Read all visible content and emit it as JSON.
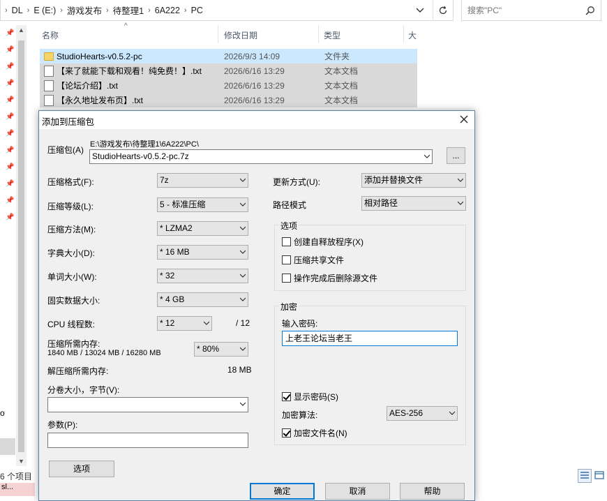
{
  "explorer": {
    "breadcrumbs": [
      "DL",
      "E (E:)",
      "游戏发布",
      "待整理1",
      "6A222",
      "PC"
    ],
    "search_placeholder": "搜索\"PC\"",
    "columns": {
      "name": "名称",
      "date": "修改日期",
      "type": "类型",
      "size": "大"
    },
    "files": [
      {
        "name": "StudioHearts-v0.5.2-pc",
        "date": "2026/9/3 14:09",
        "type": "文件夹",
        "icon": "folder-icon"
      },
      {
        "name": "【来了就能下载和观看！纯免费！】.txt",
        "date": "2026/6/16 13:29",
        "type": "文本文档",
        "icon": "text-file-icon"
      },
      {
        "name": "【论坛介绍】.txt",
        "date": "2026/6/16 13:29",
        "type": "文本文档",
        "icon": "text-file-icon"
      },
      {
        "name": "【永久地址发布页】.txt",
        "date": "2026/6/16 13:29",
        "type": "文本文档",
        "icon": "text-file-icon"
      }
    ],
    "status": "6 个项目",
    "left_edge_char": "o",
    "taskbar_text": "sl..."
  },
  "dialog": {
    "title": "添加到压缩包",
    "archive_label": "压缩包(A)",
    "archive_path": "E:\\游戏发布\\待整理1\\6A222\\PC\\",
    "archive_name": "StudioHearts-v0.5.2-pc.7z",
    "browse_label": "...",
    "format_label": "压缩格式(F):",
    "format_value": "7z",
    "level_label": "压缩等级(L):",
    "level_value": "5 - 标准压缩",
    "method_label": "压缩方法(M):",
    "method_value": "* LZMA2",
    "dict_label": "字典大小(D):",
    "dict_value": "* 16 MB",
    "word_label": "单词大小(W):",
    "word_value": "* 32",
    "solid_label": "固实数据大小:",
    "solid_value": "* 4 GB",
    "threads_label": "CPU 线程数:",
    "threads_value": "* 12",
    "threads_max": "/ 12",
    "mem_label": "压缩所需内存:",
    "mem_value": "1840 MB / 13024 MB / 16280 MB",
    "mem_percent": "* 80%",
    "decomp_label": "解压缩所需内存:",
    "decomp_value": "18 MB",
    "volume_label": "分卷大小，字节(V):",
    "params_label": "参数(P):",
    "options_button": "选项",
    "update_label": "更新方式(U):",
    "update_value": "添加并替换文件",
    "path_label": "路径模式",
    "path_value": "相对路径",
    "options_group": "选项",
    "opt_sfx": "创建自释放程序(X)",
    "opt_shared": "压缩共享文件",
    "opt_delete": "操作完成后删除源文件",
    "encrypt_group": "加密",
    "password_label": "输入密码:",
    "password_value": "上老王论坛当老王",
    "show_password": "显示密码(S)",
    "enc_method_label": "加密算法:",
    "enc_method_value": "AES-256",
    "encrypt_names": "加密文件名(N)",
    "ok": "确定",
    "cancel": "取消",
    "help": "帮助"
  }
}
